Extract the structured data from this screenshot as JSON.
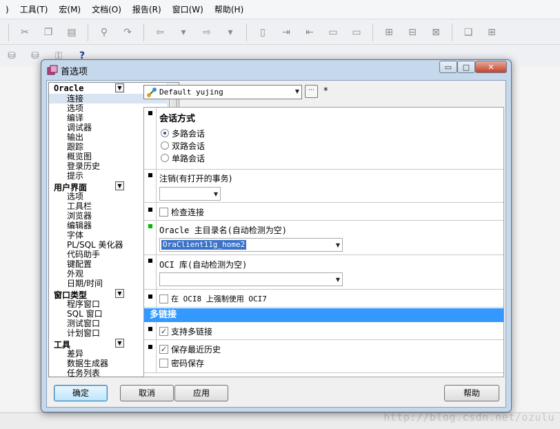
{
  "app": {
    "menus": [
      ")",
      "工具(T)",
      "宏(M)",
      "文档(O)",
      "报告(R)",
      "窗口(W)",
      "帮助(H)"
    ],
    "watermark": "http://blog.csdn.net/ozulu"
  },
  "dialog": {
    "title": "首选项",
    "caption": {
      "minimize": "▭",
      "maximize": "□",
      "close": "✕"
    },
    "tree": {
      "groups": [
        {
          "label": "Oracle",
          "items": [
            "连接",
            "选项",
            "编译",
            "调试器",
            "输出",
            "跟踪",
            "概览图",
            "登录历史",
            "提示"
          ]
        },
        {
          "label": "用户界面",
          "items": [
            "选项",
            "工具栏",
            "浏览器",
            "编辑器",
            "字体",
            "PL/SQL 美化器",
            "代码助手",
            "键配置",
            "外观",
            "日期/时间"
          ]
        },
        {
          "label": "窗口类型",
          "items": [
            "程序窗口",
            "SQL 窗口",
            "测试窗口",
            "计划窗口"
          ]
        },
        {
          "label": "工具",
          "items": [
            "差异",
            "数据生成器",
            "任务列表"
          ]
        }
      ],
      "selected": "连接"
    },
    "connection": {
      "name": "Default yujing",
      "more": "···",
      "modified": "*"
    },
    "sections": {
      "session_mode": {
        "title": "会话方式",
        "options": [
          "多路会话",
          "双路会话",
          "单路会话"
        ],
        "selected": "多路会话"
      },
      "logoff": {
        "label": "注销(有打开的事务)",
        "value": ""
      },
      "check_connection": {
        "label": "检查连接",
        "checked": false
      },
      "oracle_home": {
        "label": "Oracle 主目录名(自动检测为空)",
        "value": "OraClient11g_home2"
      },
      "oci_lib": {
        "label": "OCI 库(自动检测为空)",
        "value": ""
      },
      "force_oci7": {
        "label": "在 OCI8 上强制使用 OCI7",
        "checked": false
      },
      "multi_conn_header": "多链接",
      "support_multi": {
        "label": "支持多链接",
        "checked": true
      },
      "save_history": {
        "label": "保存最近历史",
        "checked": true
      },
      "save_password": {
        "label": "密码保存",
        "checked": false
      }
    },
    "buttons": {
      "ok": "确定",
      "cancel": "取消",
      "apply": "应用",
      "help": "帮助"
    }
  }
}
